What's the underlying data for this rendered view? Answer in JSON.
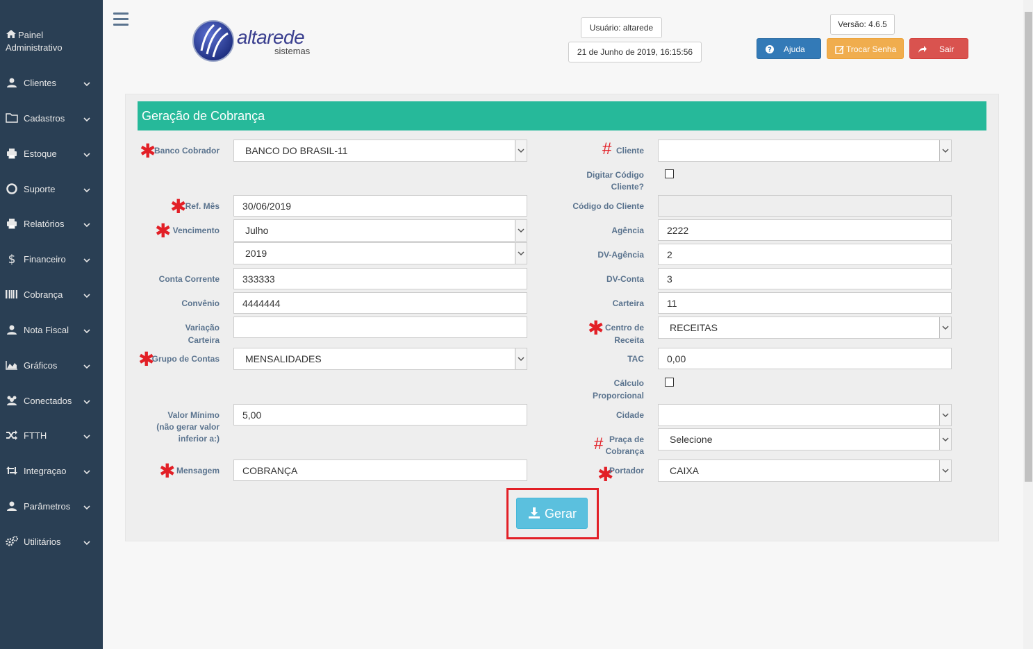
{
  "sidebar": {
    "painel": [
      "Painel",
      "Administrativo"
    ],
    "items": [
      {
        "label": "Clientes",
        "icon": "user-icon"
      },
      {
        "label": "Cadastros",
        "icon": "folder-icon"
      },
      {
        "label": "Estoque",
        "icon": "print-icon"
      },
      {
        "label": "Suporte",
        "icon": "lifebuoy-icon"
      },
      {
        "label": "Relatórios",
        "icon": "print-icon"
      },
      {
        "label": "Financeiro",
        "icon": "dollar-icon"
      },
      {
        "label": "Cobrança",
        "icon": "barcode-icon"
      },
      {
        "label": "Nota Fiscal",
        "icon": "user-icon"
      },
      {
        "label": "Gráficos",
        "icon": "area-chart-icon"
      },
      {
        "label": "Conectados",
        "icon": "users-icon"
      },
      {
        "label": "FTTH",
        "icon": "random-icon"
      },
      {
        "label": "Integraçao",
        "icon": "retweet-icon"
      },
      {
        "label": "Parâmetros",
        "icon": "user-icon"
      },
      {
        "label": "Utilitários",
        "icon": "cogs-icon"
      }
    ]
  },
  "header": {
    "logo_text": "altarede",
    "logo_sub": "sistemas",
    "usuario": "Usuário: altarede",
    "datetime": "21 de Junho de 2019, 16:15:56",
    "versao": "Versão: 4.6.5",
    "ajuda": "Ajuda",
    "trocar_senha": "Trocar Senha",
    "sair": "Sair"
  },
  "colors": {
    "sidebar": "#2a3f54",
    "title_bar": "#26b99a",
    "ajuda": "#337ab7",
    "trocar": "#f0ad4e",
    "sair": "#d9534f",
    "gerar": "#5bc0de",
    "required": "#e21f26"
  },
  "form": {
    "title": "Geração de Cobrança",
    "left": {
      "banco_label": "Banco Cobrador",
      "banco_value": "BANCO DO BRASIL-11",
      "ref_label": "Ref. Mês",
      "ref_value": "30/06/2019",
      "venc_label": "Vencimento",
      "venc_mes": "Julho",
      "venc_ano": "2019",
      "conta_label": "Conta Corrente",
      "conta_value": "333333",
      "convenio_label": "Convênio",
      "convenio_value": "4444444",
      "variacao_label": [
        "Variação",
        "Carteira"
      ],
      "variacao_value": "",
      "grupo_label": "Grupo de Contas",
      "grupo_value": "MENSALIDADES",
      "valor_label": [
        "Valor Mínimo",
        "(não gerar valor",
        "inferior a:)"
      ],
      "valor_value": "5,00",
      "mensagem_label": "Mensagem",
      "mensagem_value": "COBRANÇA"
    },
    "right": {
      "cliente_label": "Cliente",
      "cliente_value": "",
      "digitar_label": [
        "Digitar Código",
        "Cliente?"
      ],
      "codigo_label": "Código do Cliente",
      "codigo_value": "",
      "agencia_label": "Agência",
      "agencia_value": "2222",
      "dvag_label": "DV-Agência",
      "dvag_value": "2",
      "dvconta_label": "DV-Conta",
      "dvconta_value": "3",
      "carteira_label": "Carteira",
      "carteira_value": "11",
      "centro_label": [
        "Centro de",
        "Receita"
      ],
      "centro_value": "RECEITAS",
      "tac_label": "TAC",
      "tac_value": "0,00",
      "calculo_label": [
        "Cálculo",
        "Proporcional"
      ],
      "cidade_label": "Cidade",
      "cidade_value": "",
      "praca_label": [
        "Praça de",
        "Cobrança"
      ],
      "praca_value": "Selecione",
      "portador_label": "Portador",
      "portador_value": "CAIXA"
    },
    "gerar": "Gerar"
  }
}
